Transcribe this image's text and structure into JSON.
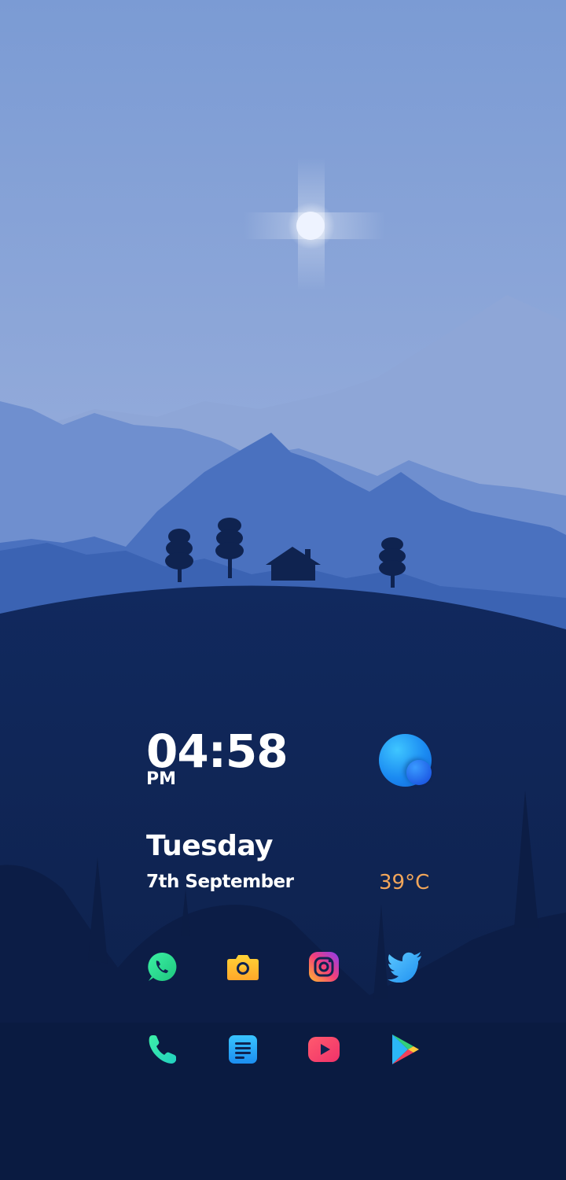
{
  "lockscreen": {
    "clock": {
      "time": "04:58",
      "ampm": "PM"
    },
    "date": {
      "day": "Tuesday",
      "full_date": "7th September"
    },
    "weather": {
      "temperature": "39°C",
      "icon": "weather-orb-icon"
    }
  },
  "dock": {
    "row1": [
      {
        "app": "WhatsApp",
        "icon": "whatsapp-icon"
      },
      {
        "app": "Camera",
        "icon": "camera-icon"
      },
      {
        "app": "Instagram",
        "icon": "instagram-icon"
      },
      {
        "app": "Twitter",
        "icon": "twitter-icon"
      }
    ],
    "row2": [
      {
        "app": "Phone",
        "icon": "phone-icon"
      },
      {
        "app": "Docs",
        "icon": "document-icon"
      },
      {
        "app": "YouTube",
        "icon": "youtube-icon"
      },
      {
        "app": "Play Store",
        "icon": "play-store-icon"
      }
    ]
  },
  "colors": {
    "sky_top": "#7fa0d6",
    "sky_bottom": "#a3b7df",
    "hill_dark": "#0f2350",
    "temperature": "#f2a65a",
    "text": "#ffffff"
  }
}
